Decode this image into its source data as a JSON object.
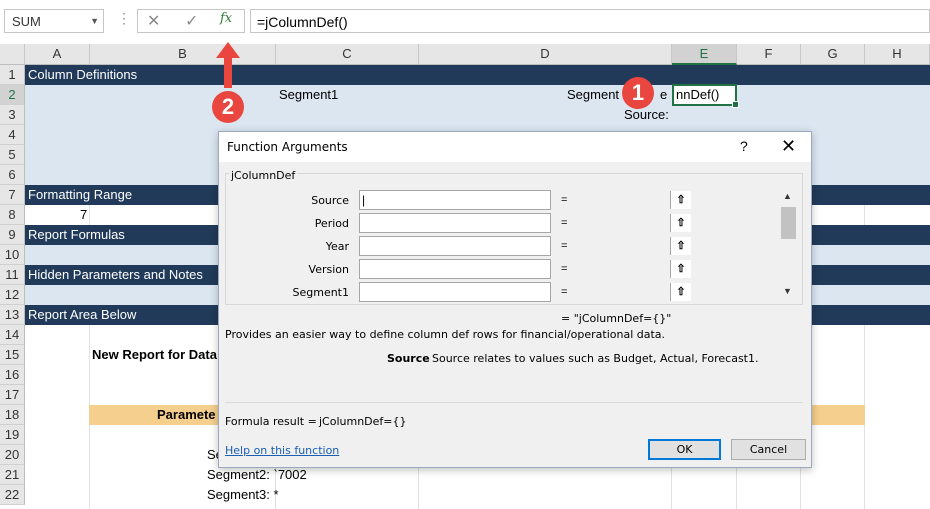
{
  "formula_bar": {
    "name_box": "SUM",
    "formula": "=jColumnDef()",
    "cancel_icon": "close-icon",
    "enter_icon": "check-icon",
    "insert_function_icon": "fx-icon",
    "insert_function_label": "fx"
  },
  "columns": [
    "A",
    "B",
    "C",
    "D",
    "E",
    "F",
    "G",
    "H"
  ],
  "rows": [
    "1",
    "2",
    "3",
    "4",
    "5",
    "6",
    "7",
    "8",
    "9",
    "10",
    "11",
    "12",
    "13",
    "14",
    "15",
    "16",
    "17",
    "18",
    "19",
    "20",
    "21",
    "22"
  ],
  "sheet": {
    "r1": "Column Definitions",
    "r2_c": "Segment1",
    "r2_d": "Segment",
    "r2_d_tail": "e",
    "r2_e": "nnDef()",
    "r3_d": "Source:",
    "r7": "Formatting Range",
    "r8_b": "7",
    "r9": "Report Formulas",
    "r11": "Hidden Parameters and Notes",
    "r13": "Report Area Below",
    "r15": "New Report for Data",
    "r18": "Paramete",
    "r20": "Se",
    "r21": "Segment2: `7002",
    "r22": "Segment3: *"
  },
  "dialog": {
    "title": "Function Arguments",
    "help": "?",
    "close": "✕",
    "function_name": "jColumnDef",
    "args": [
      {
        "label": "Source",
        "value": "|"
      },
      {
        "label": "Period",
        "value": ""
      },
      {
        "label": "Year",
        "value": ""
      },
      {
        "label": "Version",
        "value": ""
      },
      {
        "label": "Segment1",
        "value": ""
      }
    ],
    "eq": "=",
    "result_preview": "=  \"jColumnDef={}\"",
    "description": "Provides an easier way to define column def rows for financial/operational data.",
    "arg_name": "Source",
    "arg_desc": "Source relates to values such as Budget, Actual, Forecast1.",
    "formula_result_label": "Formula result =",
    "formula_result_value": "jColumnDef={}",
    "help_link": "Help on this function",
    "ok": "OK",
    "cancel": "Cancel"
  },
  "annotations": {
    "badge1": "1",
    "badge2": "2"
  },
  "colors": {
    "band": "#213a5a",
    "light_band": "#dce6f1",
    "accent": "#217346",
    "badge": "#e8463e",
    "param_band": "#f4cf8e"
  }
}
